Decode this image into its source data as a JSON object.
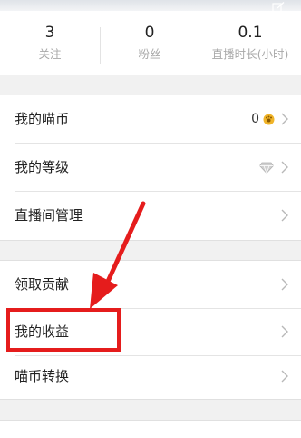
{
  "stats": [
    {
      "value": "3",
      "label": "关注"
    },
    {
      "value": "0",
      "label": "粉丝"
    },
    {
      "value": "0.1",
      "label": "直播时长(小时)"
    }
  ],
  "menu": {
    "coins": {
      "label": "我的喵币",
      "value": "0"
    },
    "level": {
      "label": "我的等级"
    },
    "room": {
      "label": "直播间管理"
    },
    "contribution": {
      "label": "领取贡献"
    },
    "earnings": {
      "label": "我的收益"
    },
    "exchange": {
      "label": "喵币转换"
    }
  },
  "colors": {
    "highlight": "#e51c1c",
    "coin": "#f0b429",
    "background": "#f1f1f1"
  },
  "icons": [
    "edit-icon",
    "coin-icon",
    "diamond-icon",
    "chevron-right-icon"
  ]
}
